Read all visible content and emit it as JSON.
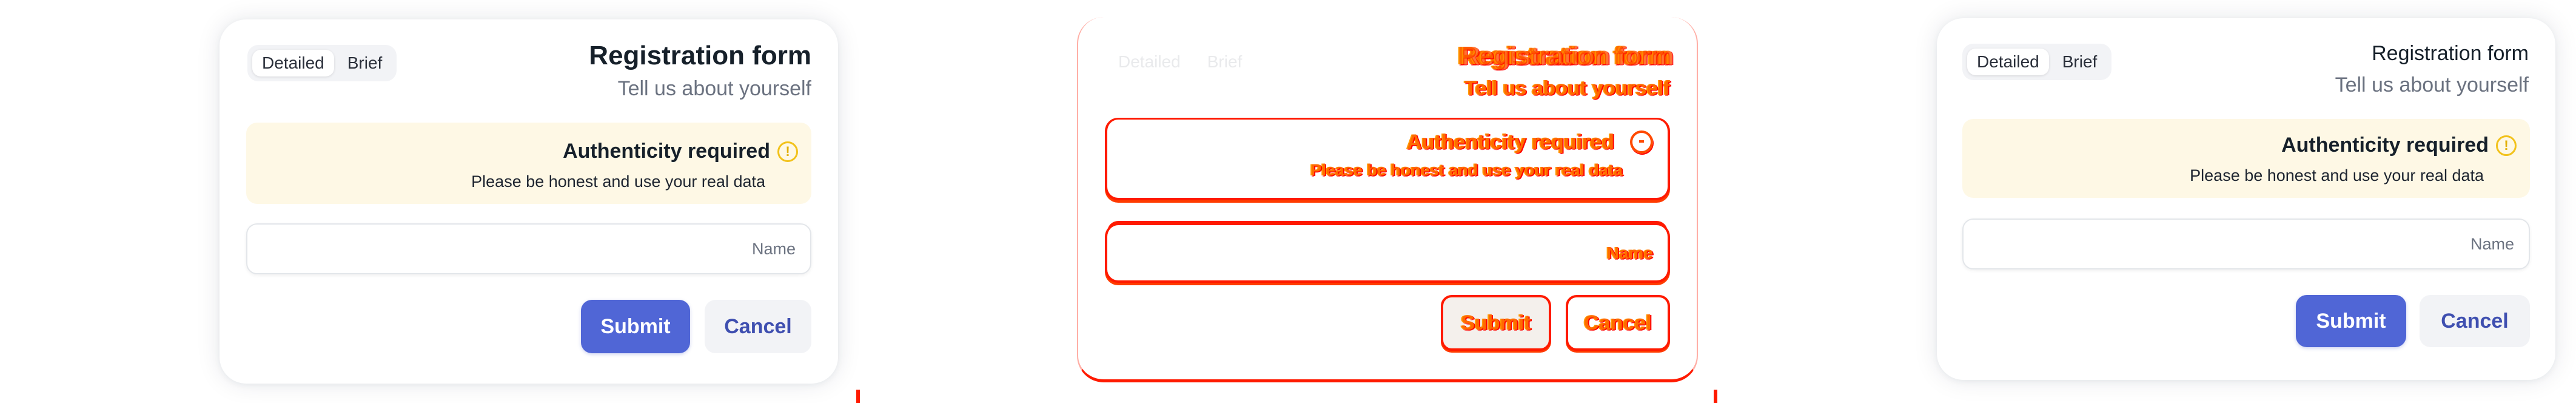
{
  "form": {
    "tabs": [
      "Detailed",
      "Brief"
    ],
    "title": "Registration form",
    "subtitle": "Tell us about yourself",
    "alert": {
      "title": "Authenticity required",
      "icon": "exclamation-circle-icon",
      "message": "Please be honest and use your real data"
    },
    "name_placeholder": "Name",
    "submit_label": "Submit",
    "cancel_label": "Cancel"
  },
  "colors": {
    "primary": "#5066d6",
    "alert_background": "#fef8e5",
    "alert_icon": "#f2c21b",
    "glitch_red": "#ff1a00",
    "glitch_orange": "#ff6a00"
  }
}
